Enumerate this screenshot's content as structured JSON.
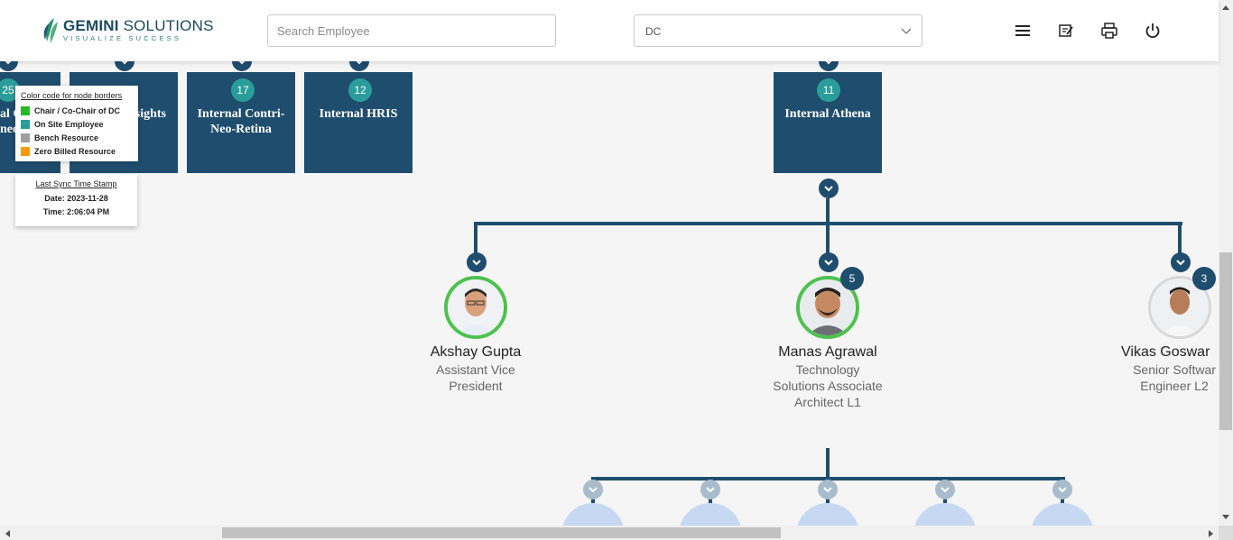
{
  "header": {
    "logo_name_bold": "GEMINI",
    "logo_name_rest": " SOLUTIONS",
    "logo_tagline": "VISUALIZE SUCCESS",
    "search_placeholder": "Search Employee",
    "dc_select_value": "DC",
    "icons": [
      "menu-icon",
      "notes-icon",
      "print-icon",
      "power-icon"
    ]
  },
  "top_nodes": [
    {
      "count": "25",
      "label": "al C\nnee"
    },
    {
      "count": "",
      "label": "sights"
    },
    {
      "count": "17",
      "label": "Internal Contri-\nNeo-Retina"
    },
    {
      "count": "12",
      "label": "Internal HRIS"
    },
    {
      "count": "11",
      "label": "Internal Athena"
    }
  ],
  "legend": {
    "title": "Color code for node borders",
    "items": [
      {
        "label": "Chair / Co-Chair of DC",
        "color": "#29b829"
      },
      {
        "label": "On Site Employee",
        "color": "#2a9d9a"
      },
      {
        "label": "Bench Resource",
        "color": "#9e9e9e"
      },
      {
        "label": "Zero Billed Resource",
        "color": "#f59b0b"
      }
    ]
  },
  "sync": {
    "title": "Last Sync Time Stamp",
    "date": "Date: 2023-11-28",
    "time": "Time: 2:06:04 PM"
  },
  "people": [
    {
      "name": "Akshay Gupta",
      "title": "Assistant Vice President",
      "count": ""
    },
    {
      "name": "Manas Agrawal",
      "title": "Technology Solutions Associate Architect L1",
      "count": "5"
    },
    {
      "name": "Vikas Goswar",
      "title": "Senior Softwar Engineer L2",
      "count": "3"
    }
  ],
  "colors": {
    "node_blue": "#1f4d6e",
    "badge_teal": "#2a9d9a",
    "chair_green": "#4dc24d"
  }
}
